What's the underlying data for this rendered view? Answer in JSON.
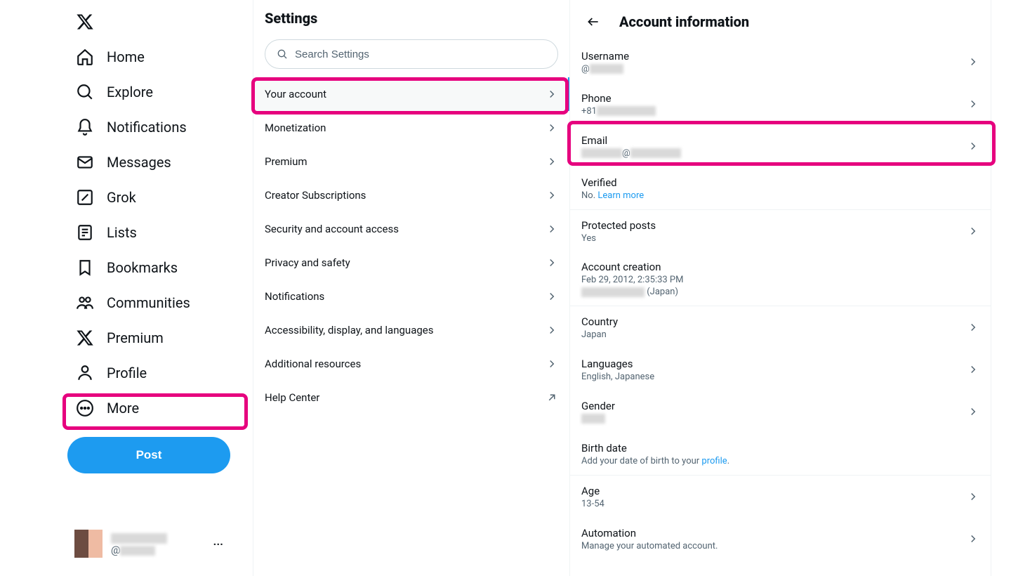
{
  "nav": {
    "home": "Home",
    "explore": "Explore",
    "notifications": "Notifications",
    "messages": "Messages",
    "grok": "Grok",
    "lists": "Lists",
    "bookmarks": "Bookmarks",
    "communities": "Communities",
    "premium": "Premium",
    "profile": "Profile",
    "more": "More",
    "post": "Post"
  },
  "account_chip": {
    "name_redacted": true,
    "handle_prefix": "@",
    "handle_redacted": true
  },
  "settings": {
    "title": "Settings",
    "search_placeholder": "Search Settings",
    "items": {
      "your_account": "Your account",
      "monetization": "Monetization",
      "premium": "Premium",
      "creator_subs": "Creator Subscriptions",
      "security": "Security and account access",
      "privacy": "Privacy and safety",
      "notifications": "Notifications",
      "accessibility": "Accessibility, display, and languages",
      "additional": "Additional resources",
      "help": "Help Center"
    }
  },
  "detail": {
    "title": "Account information",
    "username": {
      "label": "Username",
      "value_prefix": "@"
    },
    "phone": {
      "label": "Phone",
      "value_prefix": "+81"
    },
    "email": {
      "label": "Email",
      "value_mid": "@"
    },
    "verified": {
      "label": "Verified",
      "value": "No.",
      "link": "Learn more"
    },
    "protected": {
      "label": "Protected posts",
      "value": "Yes"
    },
    "creation": {
      "label": "Account creation",
      "value": "Feb 29, 2012, 2:35:33 PM",
      "loc_suffix": "(Japan)"
    },
    "country": {
      "label": "Country",
      "value": "Japan"
    },
    "languages": {
      "label": "Languages",
      "value": "English, Japanese"
    },
    "gender": {
      "label": "Gender"
    },
    "birth": {
      "label": "Birth date",
      "desc_pre": "Add your date of birth to your ",
      "link": "profile",
      "desc_post": "."
    },
    "age": {
      "label": "Age",
      "value": "13-54"
    },
    "automation": {
      "label": "Automation",
      "value": "Manage your automated account."
    }
  }
}
